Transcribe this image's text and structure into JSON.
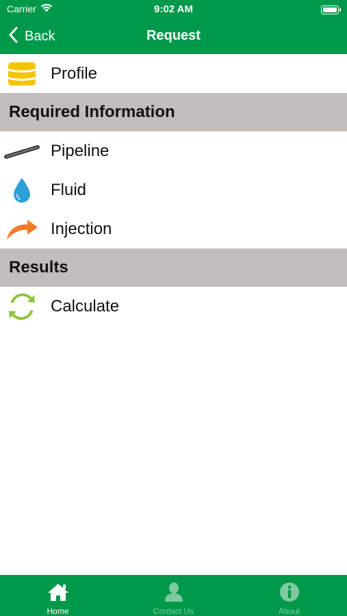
{
  "status_bar": {
    "carrier": "Carrier",
    "time": "9:02 AM"
  },
  "nav": {
    "back_label": "Back",
    "title": "Request"
  },
  "list": {
    "profile": {
      "label": "Profile",
      "icon": "database-icon"
    },
    "section_required": "Required Information",
    "pipeline": {
      "label": "Pipeline",
      "icon": "pipe-icon"
    },
    "fluid": {
      "label": "Fluid",
      "icon": "droplet-icon"
    },
    "injection": {
      "label": "Injection",
      "icon": "curved-arrow-icon"
    },
    "section_results": "Results",
    "calculate": {
      "label": "Calculate",
      "icon": "refresh-icon"
    }
  },
  "tabs": [
    {
      "label": "Home",
      "icon": "home-icon",
      "active": true
    },
    {
      "label": "Contact Us",
      "icon": "person-icon",
      "active": false
    },
    {
      "label": "About",
      "icon": "info-icon",
      "active": false
    }
  ],
  "colors": {
    "brand_green": "#00994a",
    "section_gray": "#c2bcbb",
    "profile_yellow": "#f5c400",
    "fluid_blue": "#2a9fd8",
    "injection_orange": "#f07c2c",
    "calculate_green": "#8cc63e"
  }
}
